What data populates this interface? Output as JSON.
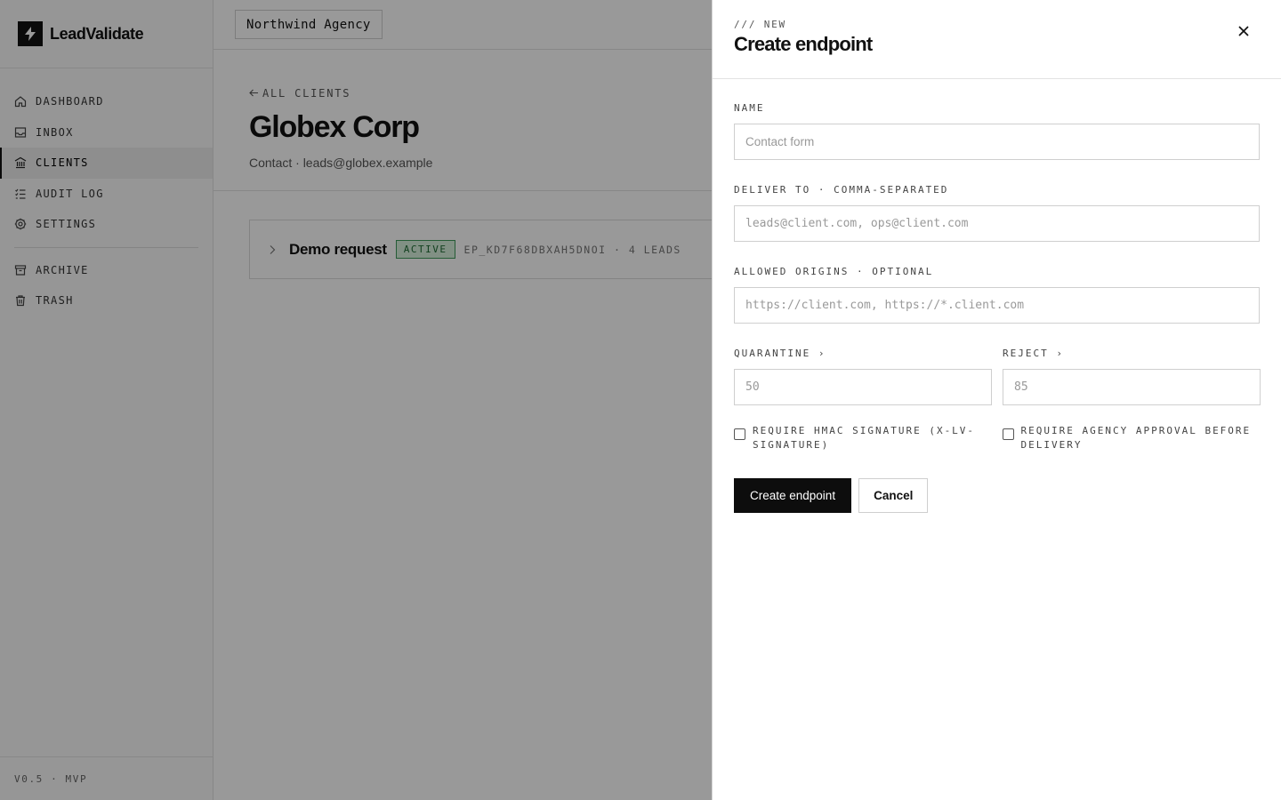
{
  "app": {
    "name": "LeadValidate",
    "version": "V0.5 · MVP"
  },
  "sidebar": {
    "items": [
      {
        "label": "DASHBOARD",
        "icon": "home-icon"
      },
      {
        "label": "INBOX",
        "icon": "inbox-icon"
      },
      {
        "label": "CLIENTS",
        "icon": "building-icon",
        "active": true
      },
      {
        "label": "AUDIT LOG",
        "icon": "list-check-icon"
      },
      {
        "label": "SETTINGS",
        "icon": "gear-icon"
      }
    ],
    "secondary": [
      {
        "label": "ARCHIVE",
        "icon": "archive-icon"
      },
      {
        "label": "TRASH",
        "icon": "trash-icon"
      }
    ]
  },
  "topbar": {
    "agency": "Northwind Agency"
  },
  "client": {
    "back_label": "ALL CLIENTS",
    "title": "Globex Corp",
    "subtitle": "Contact · leads@globex.example"
  },
  "endpoints": [
    {
      "name": "Demo request",
      "status": "ACTIVE",
      "meta": "EP_KD7F68DBXAH5DNOI · 4 LEADS"
    }
  ],
  "drawer": {
    "eyebrow": "/// NEW",
    "title": "Create endpoint",
    "fields": {
      "name": {
        "label": "NAME",
        "placeholder": "Contact form"
      },
      "deliver_to": {
        "label": "DELIVER TO · COMMA-SEPARATED",
        "placeholder": "leads@client.com, ops@client.com"
      },
      "origins": {
        "label": "ALLOWED ORIGINS · OPTIONAL",
        "placeholder": "https://client.com, https://*.client.com"
      },
      "quarantine": {
        "label": "QUARANTINE ›",
        "placeholder": "50"
      },
      "reject": {
        "label": "REJECT ›",
        "placeholder": "85"
      }
    },
    "checks": {
      "hmac": {
        "label": "REQUIRE HMAC SIGNATURE (X-LV-SIGNATURE)",
        "checked": false
      },
      "approval": {
        "label": "REQUIRE AGENCY APPROVAL BEFORE DELIVERY",
        "checked": false
      }
    },
    "submit_label": "Create endpoint",
    "cancel_label": "Cancel"
  },
  "colors": {
    "accent": "#0d0d0d",
    "status_active_bg": "#d7f0dc",
    "status_active_text": "#1f6b34",
    "overlay": "rgba(0,0,0,0.4)"
  }
}
